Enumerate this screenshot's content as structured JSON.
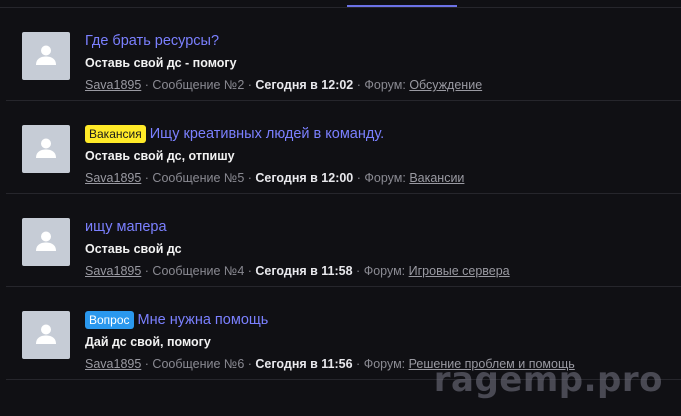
{
  "results": [
    {
      "prefix": "",
      "title": "Где брать ресурсы?",
      "snippet": "Оставь свой дс - помогу",
      "author": "Sava1895",
      "message": "Сообщение №2",
      "date": "Сегодня в 12:02",
      "forum_label": "Форум:",
      "forum": "Обсуждение"
    },
    {
      "prefix": "Вакансия",
      "prefix_type": "vacancy",
      "title": "Ищу креативных людей в команду.",
      "snippet": "Оставь свой дс, отпишу",
      "author": "Sava1895",
      "message": "Сообщение №5",
      "date": "Сегодня в 12:00",
      "forum_label": "Форум:",
      "forum": "Вакансии"
    },
    {
      "prefix": "",
      "title": "ищу мапера",
      "snippet": "Оставь свой дс",
      "author": "Sava1895",
      "message": "Сообщение №4",
      "date": "Сегодня в 11:58",
      "forum_label": "Форум:",
      "forum": "Игровые сервера"
    },
    {
      "prefix": "Вопрос",
      "prefix_type": "question",
      "title": "Мне нужна помощь",
      "snippet": "Дай дс свой, помогу",
      "author": "Sava1895",
      "message": "Сообщение №6",
      "date": "Сегодня в 11:56",
      "forum_label": "Форум:",
      "forum": "Решение проблем и помощь"
    }
  ],
  "separator": " · ",
  "watermark": "ragemp.pro",
  "colors": {
    "background": "#101014",
    "title_link": "#7b80ff",
    "vacancy_prefix": "#ffea28",
    "question_prefix": "#2a98ee",
    "tab_underline": "#6c72e6"
  },
  "icons": {
    "avatar": "user-silhouette-icon"
  }
}
